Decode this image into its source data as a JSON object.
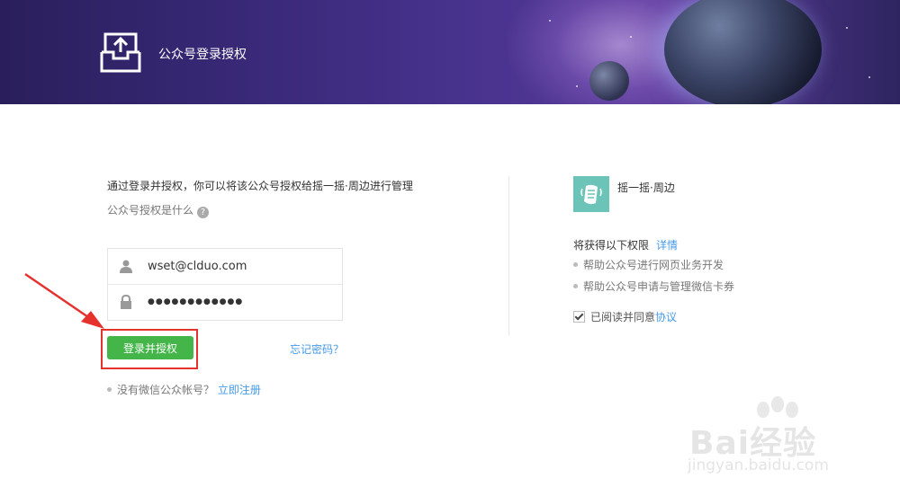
{
  "header": {
    "title": "公众号登录授权",
    "logo_icon": "upload-tray-icon"
  },
  "intro": {
    "text": "通过登录并授权，你可以将该公众号授权给摇一摇·周边进行管理",
    "what_label": "公众号授权是什么",
    "help_icon": "question-icon"
  },
  "login": {
    "username_value": "wset@clduo.com",
    "password_value": "●●●●●●●●●●●●",
    "username_icon": "user-icon",
    "password_icon": "lock-icon",
    "submit_label": "登录并授权",
    "forgot_label": "忘记密码？",
    "no_account_label": "没有微信公众帐号？",
    "register_label": "立即注册"
  },
  "app": {
    "name": "摇一摇·周边",
    "icon": "shake-hand-icon",
    "icon_color": "#6cc4b8"
  },
  "permissions": {
    "title": "将获得以下权限",
    "detail_label": "详情",
    "items": [
      "帮助公众号进行网页业务开发",
      "帮助公众号申请与管理微信卡券"
    ],
    "agree_text": "已阅读并同意",
    "agree_link": "协议",
    "agree_checked": true
  },
  "watermark": {
    "main": "Bai经验",
    "sub": "jingyan.baidu.com"
  },
  "colors": {
    "accent_green": "#44b549",
    "link_blue": "#459ae9",
    "highlight_red": "#e5322d",
    "header_purple": "#3a2a7a"
  }
}
